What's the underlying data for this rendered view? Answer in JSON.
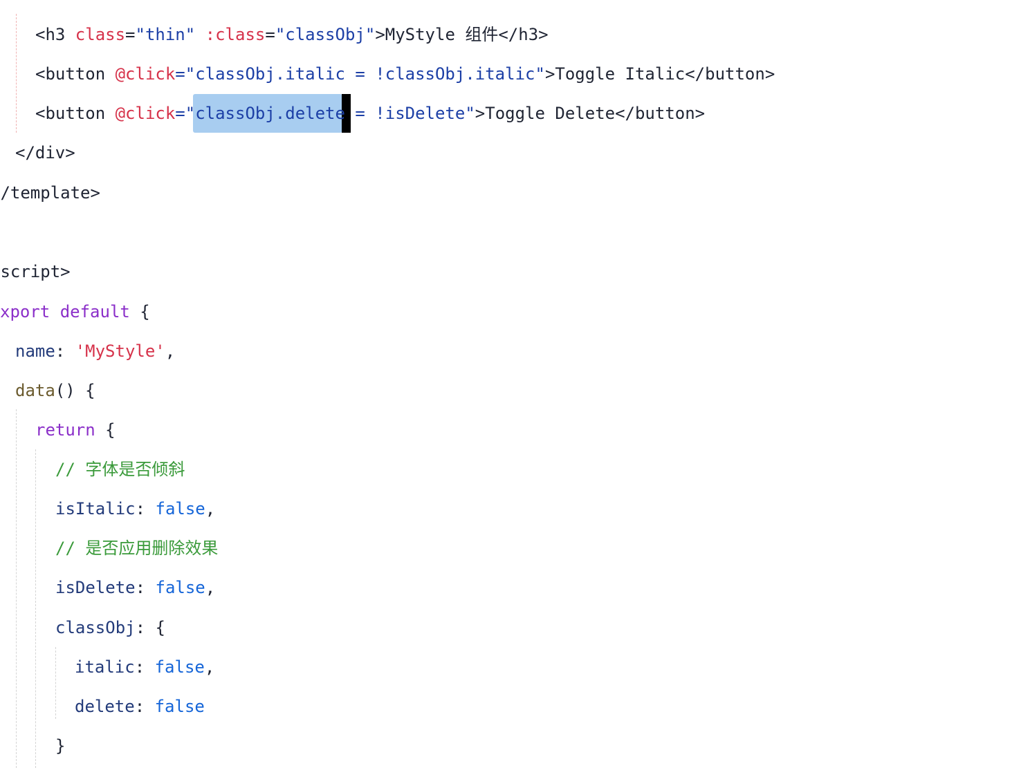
{
  "theme": {
    "text": "#1f2433",
    "tag": "#1f2433",
    "attr": "#d6324a",
    "string": "#1c3fa6",
    "keyword": "#8b2fc9",
    "property": "#233b7a",
    "value": "#1565d8",
    "comment": "#3a9a3a",
    "func": "#6b5b2e",
    "selection": "#a8cdf0",
    "cursor": "#000000"
  },
  "code": {
    "lines": [
      {
        "tokens": [
          {
            "text": "<h3 ",
            "kind": "tag"
          },
          {
            "text": "class",
            "kind": "attr"
          },
          {
            "text": "=",
            "kind": "text"
          },
          {
            "text": "\"thin\"",
            "kind": "string"
          },
          {
            "text": " ",
            "kind": "text"
          },
          {
            "text": ":class",
            "kind": "attr"
          },
          {
            "text": "=",
            "kind": "text"
          },
          {
            "text": "\"classObj\"",
            "kind": "string"
          },
          {
            "text": ">MyStyle 组件</h3>",
            "kind": "tag"
          }
        ]
      },
      {
        "tokens": [
          {
            "text": "<button ",
            "kind": "tag"
          },
          {
            "text": "@click",
            "kind": "attr"
          },
          {
            "text": "=\"",
            "kind": "string"
          },
          {
            "text": "classObj.italic = !classObj.italic",
            "kind": "string"
          },
          {
            "text": "\"",
            "kind": "string"
          },
          {
            "text": ">Toggle Italic</button>",
            "kind": "tag"
          }
        ]
      },
      {
        "tokens": [
          {
            "text": "<button ",
            "kind": "tag"
          },
          {
            "text": "@click",
            "kind": "attr"
          },
          {
            "text": "=\"",
            "kind": "string"
          },
          {
            "text": "classObj.delete",
            "kind": "string"
          },
          {
            "text": " = !isDelete",
            "kind": "string"
          },
          {
            "text": "\"",
            "kind": "string"
          },
          {
            "text": ">Toggle Delete</button>",
            "kind": "tag"
          }
        ]
      },
      {
        "tokens": [
          {
            "text": "</div>",
            "kind": "tag"
          }
        ]
      },
      {
        "tokens": [
          {
            "text": "</template>",
            "kind": "tag"
          }
        ]
      },
      {
        "tokens": [
          {
            "text": "<script>",
            "kind": "tag"
          }
        ]
      },
      {
        "tokens": [
          {
            "text": "xport",
            "kind": "keyword"
          },
          {
            "text": " ",
            "kind": "text"
          },
          {
            "text": "default",
            "kind": "keyword"
          },
          {
            "text": " {",
            "kind": "text"
          }
        ]
      },
      {
        "tokens": [
          {
            "text": "name",
            "kind": "property"
          },
          {
            "text": ": ",
            "kind": "text"
          },
          {
            "text": "'MyStyle'",
            "kind": "attr"
          },
          {
            "text": ",",
            "kind": "text"
          }
        ]
      },
      {
        "tokens": [
          {
            "text": "data",
            "kind": "func"
          },
          {
            "text": "() {",
            "kind": "text"
          }
        ]
      },
      {
        "tokens": [
          {
            "text": "return",
            "kind": "keyword"
          },
          {
            "text": " {",
            "kind": "text"
          }
        ]
      },
      {
        "tokens": [
          {
            "text": "// 字体是否倾斜",
            "kind": "comment"
          }
        ]
      },
      {
        "tokens": [
          {
            "text": "isItalic",
            "kind": "property"
          },
          {
            "text": ": ",
            "kind": "text"
          },
          {
            "text": "false",
            "kind": "value"
          },
          {
            "text": ",",
            "kind": "text"
          }
        ]
      },
      {
        "tokens": [
          {
            "text": "// 是否应用删除效果",
            "kind": "comment"
          }
        ]
      },
      {
        "tokens": [
          {
            "text": "isDelete",
            "kind": "property"
          },
          {
            "text": ": ",
            "kind": "text"
          },
          {
            "text": "false",
            "kind": "value"
          },
          {
            "text": ",",
            "kind": "text"
          }
        ]
      },
      {
        "tokens": [
          {
            "text": "classObj",
            "kind": "property"
          },
          {
            "text": ": {",
            "kind": "text"
          }
        ]
      },
      {
        "tokens": [
          {
            "text": "italic",
            "kind": "property"
          },
          {
            "text": ": ",
            "kind": "text"
          },
          {
            "text": "false",
            "kind": "value"
          },
          {
            "text": ",",
            "kind": "text"
          }
        ]
      },
      {
        "tokens": [
          {
            "text": "delete",
            "kind": "property"
          },
          {
            "text": ": ",
            "kind": "text"
          },
          {
            "text": "false",
            "kind": "value"
          }
        ]
      },
      {
        "tokens": [
          {
            "text": "}",
            "kind": "text"
          }
        ]
      }
    ]
  }
}
